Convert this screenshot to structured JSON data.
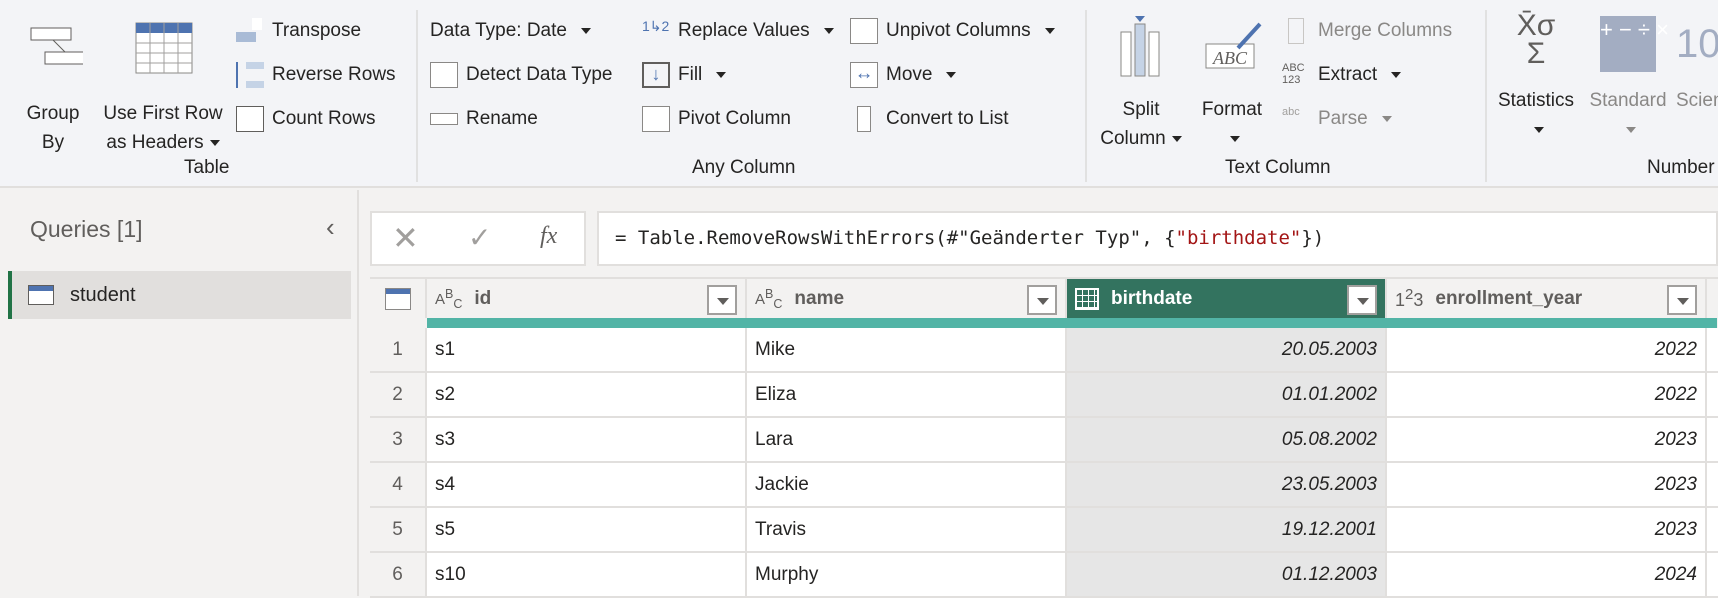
{
  "ribbon": {
    "groups": {
      "table": "Table",
      "any_column": "Any Column",
      "text_column": "Text Column",
      "number": "Number"
    },
    "table": {
      "group_by": [
        "Group",
        "By"
      ],
      "use_first_row": [
        "Use First Row",
        "as Headers"
      ],
      "transpose": "Transpose",
      "reverse_rows": "Reverse Rows",
      "count_rows": "Count Rows"
    },
    "any_column": {
      "data_type": "Data Type: Date",
      "detect_data_type": "Detect Data Type",
      "rename": "Rename",
      "replace_values": "Replace Values",
      "fill": "Fill",
      "pivot_column": "Pivot Column",
      "unpivot_columns": "Unpivot Columns",
      "move": "Move",
      "convert_to_list": "Convert to List"
    },
    "text_column": {
      "split_column": [
        "Split",
        "Column"
      ],
      "format": "Format",
      "merge_columns": "Merge Columns",
      "extract": "Extract",
      "parse": "Parse"
    },
    "number": {
      "statistics": "Statistics",
      "standard": "Standard",
      "scientific": "Scien"
    }
  },
  "queries": {
    "title": "Queries [1]",
    "items": [
      {
        "label": "student"
      }
    ]
  },
  "formula": {
    "prefix": "= Table.RemoveRowsWithErrors(#\"Geänderter Typ\", {",
    "arg": "\"birthdate\"",
    "suffix": "})"
  },
  "table": {
    "columns": [
      {
        "name": "id",
        "type": "ABC"
      },
      {
        "name": "name",
        "type": "ABC"
      },
      {
        "name": "birthdate",
        "type": "date"
      },
      {
        "name": "enrollment_year",
        "type": "123"
      }
    ],
    "rows": [
      {
        "n": "1",
        "id": "s1",
        "name": "Mike",
        "birthdate": "20.05.2003",
        "year": "2022"
      },
      {
        "n": "2",
        "id": "s2",
        "name": "Eliza",
        "birthdate": "01.01.2002",
        "year": "2022"
      },
      {
        "n": "3",
        "id": "s3",
        "name": "Lara",
        "birthdate": "05.08.2002",
        "year": "2023"
      },
      {
        "n": "4",
        "id": "s4",
        "name": "Jackie",
        "birthdate": "23.05.2003",
        "year": "2023"
      },
      {
        "n": "5",
        "id": "s5",
        "name": "Travis",
        "birthdate": "19.12.2001",
        "year": "2023"
      },
      {
        "n": "6",
        "id": "s10",
        "name": "Murphy",
        "birthdate": "01.12.2003",
        "year": "2024"
      }
    ]
  },
  "colors": {
    "accent": "#217346",
    "selected_header": "#33735f",
    "teal": "#52b4a6"
  }
}
